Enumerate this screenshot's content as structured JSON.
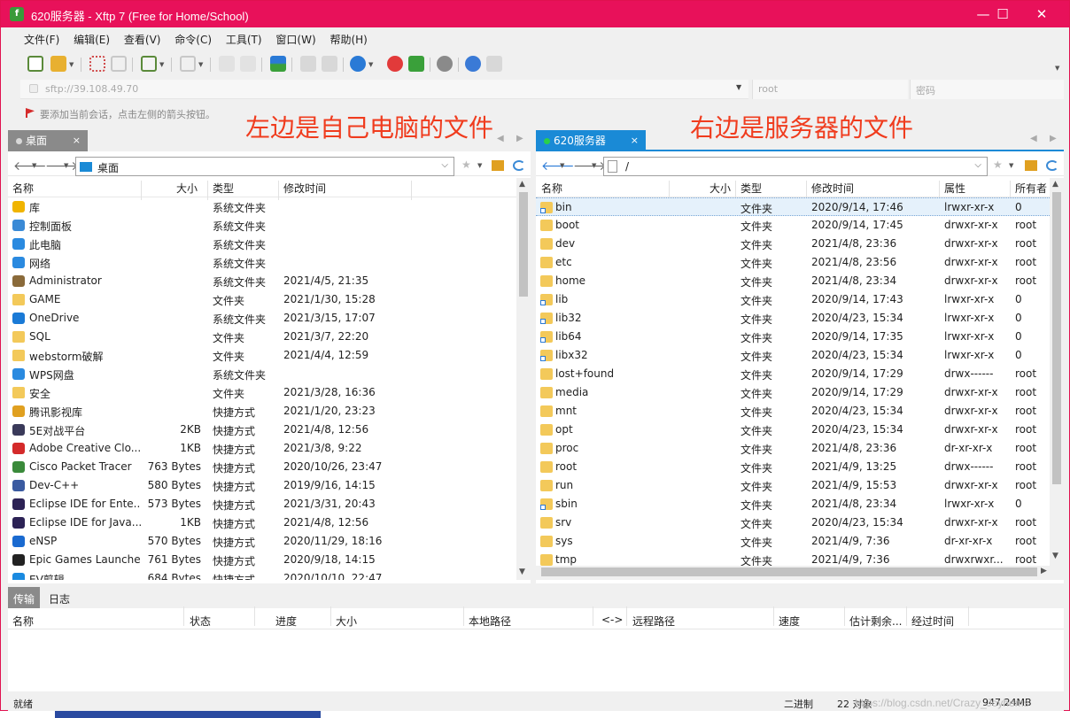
{
  "window": {
    "title": "620服务器 - Xftp 7 (Free for Home/School)",
    "minimize": "—",
    "maximize": "☐",
    "close": "✕",
    "accent": "#e8115a"
  },
  "menu": [
    "文件(F)",
    "编辑(E)",
    "查看(V)",
    "命令(C)",
    "工具(T)",
    "窗口(W)",
    "帮助(H)"
  ],
  "address": {
    "value": "sftp://39.108.49.70",
    "user_placeholder": "root",
    "password_placeholder": "密码"
  },
  "hint": "要添加当前会话，点击左侧的箭头按钮。",
  "annotations": {
    "left": "左边是自己电脑的文件",
    "right": "右边是服务器的文件"
  },
  "left_pane": {
    "tab": "桌面",
    "path": "桌面",
    "columns": [
      "名称",
      "大小",
      "类型",
      "修改时间"
    ],
    "rows": [
      {
        "name": "库",
        "size": "",
        "type": "系统文件夹",
        "mtime": "",
        "icon": "library-icon",
        "color": "#f0b400"
      },
      {
        "name": "控制面板",
        "size": "",
        "type": "系统文件夹",
        "mtime": "",
        "icon": "control-panel-icon",
        "color": "#3a8ad6"
      },
      {
        "name": "此电脑",
        "size": "",
        "type": "系统文件夹",
        "mtime": "",
        "icon": "computer-icon",
        "color": "#2a8ae0"
      },
      {
        "name": "网络",
        "size": "",
        "type": "系统文件夹",
        "mtime": "",
        "icon": "network-icon",
        "color": "#2a8ae0"
      },
      {
        "name": "Administrator",
        "size": "",
        "type": "系统文件夹",
        "mtime": "2021/4/5, 21:35",
        "icon": "user-folder-icon",
        "color": "#8a6a3a"
      },
      {
        "name": "GAME",
        "size": "",
        "type": "文件夹",
        "mtime": "2021/1/30, 15:28",
        "icon": "folder-icon",
        "color": "#f3c95a"
      },
      {
        "name": "OneDrive",
        "size": "",
        "type": "系统文件夹",
        "mtime": "2021/3/15, 17:07",
        "icon": "onedrive-icon",
        "color": "#1a7ad6"
      },
      {
        "name": "SQL",
        "size": "",
        "type": "文件夹",
        "mtime": "2021/3/7, 22:20",
        "icon": "folder-icon",
        "color": "#f3c95a"
      },
      {
        "name": "webstorm破解",
        "size": "",
        "type": "文件夹",
        "mtime": "2021/4/4, 12:59",
        "icon": "folder-icon",
        "color": "#f3c95a"
      },
      {
        "name": "WPS网盘",
        "size": "",
        "type": "系统文件夹",
        "mtime": "",
        "icon": "cloud-icon",
        "color": "#2a8ae0"
      },
      {
        "name": "安全",
        "size": "",
        "type": "文件夹",
        "mtime": "2021/3/28, 16:36",
        "icon": "folder-icon",
        "color": "#f3c95a"
      },
      {
        "name": "腾讯影视库",
        "size": "",
        "type": "快捷方式",
        "mtime": "2021/1/20, 23:23",
        "icon": "shortcut-folder-icon",
        "color": "#e0a020"
      },
      {
        "name": "5E对战平台",
        "size": "2KB",
        "type": "快捷方式",
        "mtime": "2021/4/8, 12:56",
        "icon": "app-icon",
        "color": "#3a3a5a"
      },
      {
        "name": "Adobe Creative Clo...",
        "size": "1KB",
        "type": "快捷方式",
        "mtime": "2021/3/8, 9:22",
        "icon": "app-icon",
        "color": "#d42a2a"
      },
      {
        "name": "Cisco Packet Tracer",
        "size": "763 Bytes",
        "type": "快捷方式",
        "mtime": "2020/10/26, 23:47",
        "icon": "app-icon",
        "color": "#3a8a3a"
      },
      {
        "name": "Dev-C++",
        "size": "580 Bytes",
        "type": "快捷方式",
        "mtime": "2019/9/16, 14:15",
        "icon": "app-icon",
        "color": "#3a5aa0"
      },
      {
        "name": "Eclipse IDE for Ente...",
        "size": "573 Bytes",
        "type": "快捷方式",
        "mtime": "2021/3/31, 20:43",
        "icon": "app-icon",
        "color": "#2c2255"
      },
      {
        "name": "Eclipse IDE for Java...",
        "size": "1KB",
        "type": "快捷方式",
        "mtime": "2021/4/8, 12:56",
        "icon": "app-icon",
        "color": "#2c2255"
      },
      {
        "name": "eNSP",
        "size": "570 Bytes",
        "type": "快捷方式",
        "mtime": "2020/11/29, 18:16",
        "icon": "app-icon",
        "color": "#1a6ad0"
      },
      {
        "name": "Epic Games Launcher",
        "size": "761 Bytes",
        "type": "快捷方式",
        "mtime": "2020/9/18, 14:15",
        "icon": "app-icon",
        "color": "#222222"
      },
      {
        "name": "EV剪辑",
        "size": "684 Bytes",
        "type": "快捷方式",
        "mtime": "2020/10/10, 22:47",
        "icon": "app-icon",
        "color": "#1a8ae0"
      }
    ]
  },
  "right_pane": {
    "tab": "620服务器",
    "path": "/",
    "columns": [
      "名称",
      "大小",
      "类型",
      "修改时间",
      "属性",
      "所有者"
    ],
    "rows": [
      {
        "name": "bin",
        "size": "",
        "type": "文件夹",
        "mtime": "2020/9/14, 17:46",
        "attr": "lrwxr-xr-x",
        "owner": "0",
        "link": true
      },
      {
        "name": "boot",
        "size": "",
        "type": "文件夹",
        "mtime": "2020/9/14, 17:45",
        "attr": "drwxr-xr-x",
        "owner": "root",
        "link": false
      },
      {
        "name": "dev",
        "size": "",
        "type": "文件夹",
        "mtime": "2021/4/8, 23:36",
        "attr": "drwxr-xr-x",
        "owner": "root",
        "link": false
      },
      {
        "name": "etc",
        "size": "",
        "type": "文件夹",
        "mtime": "2021/4/8, 23:56",
        "attr": "drwxr-xr-x",
        "owner": "root",
        "link": false
      },
      {
        "name": "home",
        "size": "",
        "type": "文件夹",
        "mtime": "2021/4/8, 23:34",
        "attr": "drwxr-xr-x",
        "owner": "root",
        "link": false
      },
      {
        "name": "lib",
        "size": "",
        "type": "文件夹",
        "mtime": "2020/9/14, 17:43",
        "attr": "lrwxr-xr-x",
        "owner": "0",
        "link": true
      },
      {
        "name": "lib32",
        "size": "",
        "type": "文件夹",
        "mtime": "2020/4/23, 15:34",
        "attr": "lrwxr-xr-x",
        "owner": "0",
        "link": true
      },
      {
        "name": "lib64",
        "size": "",
        "type": "文件夹",
        "mtime": "2020/9/14, 17:35",
        "attr": "lrwxr-xr-x",
        "owner": "0",
        "link": true
      },
      {
        "name": "libx32",
        "size": "",
        "type": "文件夹",
        "mtime": "2020/4/23, 15:34",
        "attr": "lrwxr-xr-x",
        "owner": "0",
        "link": true
      },
      {
        "name": "lost+found",
        "size": "",
        "type": "文件夹",
        "mtime": "2020/9/14, 17:29",
        "attr": "drwx------",
        "owner": "root",
        "link": false
      },
      {
        "name": "media",
        "size": "",
        "type": "文件夹",
        "mtime": "2020/9/14, 17:29",
        "attr": "drwxr-xr-x",
        "owner": "root",
        "link": false
      },
      {
        "name": "mnt",
        "size": "",
        "type": "文件夹",
        "mtime": "2020/4/23, 15:34",
        "attr": "drwxr-xr-x",
        "owner": "root",
        "link": false
      },
      {
        "name": "opt",
        "size": "",
        "type": "文件夹",
        "mtime": "2020/4/23, 15:34",
        "attr": "drwxr-xr-x",
        "owner": "root",
        "link": false
      },
      {
        "name": "proc",
        "size": "",
        "type": "文件夹",
        "mtime": "2021/4/8, 23:36",
        "attr": "dr-xr-xr-x",
        "owner": "root",
        "link": false
      },
      {
        "name": "root",
        "size": "",
        "type": "文件夹",
        "mtime": "2021/4/9, 13:25",
        "attr": "drwx------",
        "owner": "root",
        "link": false
      },
      {
        "name": "run",
        "size": "",
        "type": "文件夹",
        "mtime": "2021/4/9, 15:53",
        "attr": "drwxr-xr-x",
        "owner": "root",
        "link": false
      },
      {
        "name": "sbin",
        "size": "",
        "type": "文件夹",
        "mtime": "2021/4/8, 23:34",
        "attr": "lrwxr-xr-x",
        "owner": "0",
        "link": true
      },
      {
        "name": "srv",
        "size": "",
        "type": "文件夹",
        "mtime": "2020/4/23, 15:34",
        "attr": "drwxr-xr-x",
        "owner": "root",
        "link": false
      },
      {
        "name": "sys",
        "size": "",
        "type": "文件夹",
        "mtime": "2021/4/9, 7:36",
        "attr": "dr-xr-xr-x",
        "owner": "root",
        "link": false
      },
      {
        "name": "tmp",
        "size": "",
        "type": "文件夹",
        "mtime": "2021/4/9, 7:36",
        "attr": "drwxrwxr...",
        "owner": "root",
        "link": false
      }
    ]
  },
  "transfer": {
    "tabs": [
      "传输",
      "日志"
    ],
    "columns": [
      "名称",
      "状态",
      "进度",
      "大小",
      "本地路径",
      "<->",
      "远程路径",
      "速度",
      "估计剩余...",
      "经过时间"
    ]
  },
  "status": {
    "left": "就绪",
    "mode": "二进制",
    "count": "22 对象",
    "size": "947.24MB"
  },
  "watermark": "https://blog.csdn.net/Crazy_Joyhems"
}
